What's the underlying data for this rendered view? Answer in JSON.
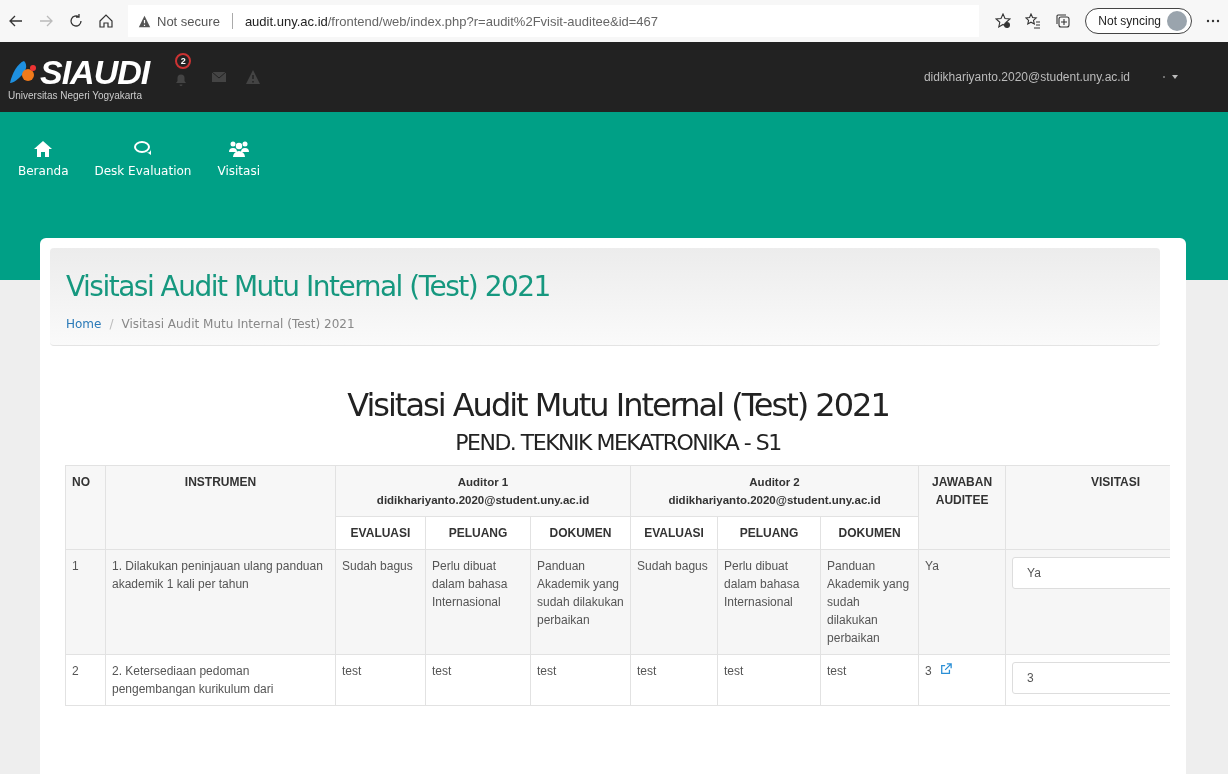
{
  "browser": {
    "security": "Not secure",
    "url_host": "audit.uny.ac.id",
    "url_path": "/frontend/web/index.php?r=audit%2Fvisit-auditee&id=467",
    "sync_button": "Not syncing"
  },
  "header": {
    "logo_text": "SIAUDI",
    "logo_subtitle": "Universitas Negeri Yogyakarta",
    "notification_count": "2",
    "user_email": "didikhariyanto.2020@student.uny.ac.id"
  },
  "nav": [
    {
      "label": "Beranda"
    },
    {
      "label": "Desk Evaluation"
    },
    {
      "label": "Visitasi"
    }
  ],
  "page_header": {
    "title": "Visitasi Audit Mutu Internal (Test) 2021",
    "breadcrumb": [
      "Home",
      "Visitasi Audit Mutu Internal (Test) 2021"
    ],
    "breadcrumb_separator": "/"
  },
  "content": {
    "title": "Visitasi Audit Mutu Internal (Test) 2021",
    "subtitle": "PEND. TEKNIK MEKATRONIKA - S1"
  },
  "table": {
    "columns": {
      "no": "NO",
      "instrumen": "INSTRUMEN",
      "jawaban": "JAWABAN AUDITEE",
      "visitasi": "VISITASI"
    },
    "auditors": [
      {
        "title": "Auditor 1",
        "email": "didikhariyanto.2020@student.uny.ac.id",
        "sub": [
          "EVALUASI",
          "PELUANG",
          "DOKUMEN"
        ]
      },
      {
        "title": "Auditor 2",
        "email": "didikhariyanto.2020@student.uny.ac.id",
        "sub": [
          "EVALUASI",
          "PELUANG",
          "DOKUMEN"
        ]
      }
    ],
    "rows": [
      {
        "no": "1",
        "instrumen": "1. Dilakukan peninjauan ulang panduan akademik 1 kali per tahun",
        "auditor_cells": [
          [
            "Sudah bagus",
            "Perlu dibuat dalam bahasa Internasional",
            "Panduan Akademik yang sudah dilakukan perbaikan"
          ],
          [
            "Sudah bagus",
            "Perlu dibuat dalam bahasa Internasional",
            "Panduan Akademik yang sudah dilakukan perbaikan"
          ]
        ],
        "jawaban": "Ya",
        "jawaban_link": false,
        "visitasi": "Ya"
      },
      {
        "no": "2",
        "instrumen": "2. Ketersediaan pedoman pengembangan kurikulum dari",
        "auditor_cells": [
          [
            "test",
            "test",
            "test"
          ],
          [
            "test",
            "test",
            "test"
          ]
        ],
        "jawaban": "3",
        "jawaban_link": true,
        "visitasi": "3"
      }
    ]
  }
}
